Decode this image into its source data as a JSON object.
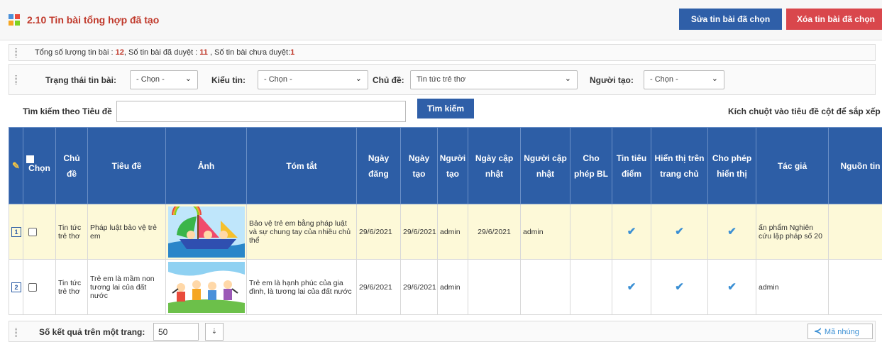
{
  "header": {
    "title": "2.10 Tin bài tổng hợp đã tạo",
    "edit_button": "Sửa tin bài đã chọn",
    "delete_button": "Xóa tin bài đã chọn",
    "icon_colors": [
      "#4a90d9",
      "#e94b3c",
      "#f5a623",
      "#7ed321"
    ]
  },
  "summary": {
    "total_label": "Tổng số lượng tin bài : ",
    "total": "12",
    "approved_label": ", Số tin bài đã duyệt : ",
    "approved": "11",
    "pending_label": " , Số tin bài chưa duyệt:",
    "pending": "1"
  },
  "filters": {
    "status_label": "Trạng thái tin bài:",
    "status_value": "- Chọn -",
    "type_label": "Kiểu tin:",
    "type_value": "- Chọn -",
    "topic_label": "Chủ đề:",
    "topic_value": "Tin tức trẻ thơ",
    "creator_label": "Người tạo:",
    "creator_value": "- Chọn -"
  },
  "search": {
    "label": "Tìm kiếm theo Tiêu đề",
    "value": "",
    "button": "Tìm kiếm",
    "sort_hint": "Kích chuột vào tiêu đề cột để sắp xếp"
  },
  "table": {
    "headers": {
      "select": "Chọn",
      "topic": "Chủ đề",
      "title": "Tiêu đề",
      "image": "Ảnh",
      "summary": "Tóm tắt",
      "published": "Ngày đăng",
      "created": "Ngày tạo",
      "creator": "Người tạo",
      "updated": "Ngày cập nhật",
      "updater": "Người cập nhật",
      "allow_comment": "Cho phép BL",
      "featured": "Tin tiêu điểm",
      "show_home": "Hiển thị trên trang chủ",
      "allow_display": "Cho phép hiển thị",
      "author": "Tác giả",
      "source": "Nguồn tin"
    },
    "rows": [
      {
        "index": "1",
        "topic": "Tin tức trẻ thơ",
        "title": "Pháp luật bảo vệ trẻ em",
        "summary": "Bảo vệ trẻ em bằng pháp luật và sự chung tay của nhiều chủ thể",
        "published": "29/6/2021",
        "created": "29/6/2021",
        "creator": "admin",
        "updated": "29/6/2021",
        "updater": "admin",
        "featured": true,
        "show_home": true,
        "allow_display": true,
        "author": "ấn phẩm Nghiên cứu lập pháp số 20",
        "source": ""
      },
      {
        "index": "2",
        "topic": "Tin tức trẻ thơ",
        "title": "Trẻ em là mầm non tương lai của đất nước",
        "summary": "Trẻ em là hạnh phúc của gia đình, là tương lai của đất nước",
        "published": "29/6/2021",
        "created": "29/6/2021",
        "creator": "admin",
        "updated": "",
        "updater": "",
        "featured": true,
        "show_home": true,
        "allow_display": true,
        "author": "admin",
        "source": ""
      }
    ]
  },
  "footer": {
    "per_page_label": "Số kết quả trên một trang:",
    "per_page_value": "50",
    "embed_label": "Mã nhúng"
  }
}
